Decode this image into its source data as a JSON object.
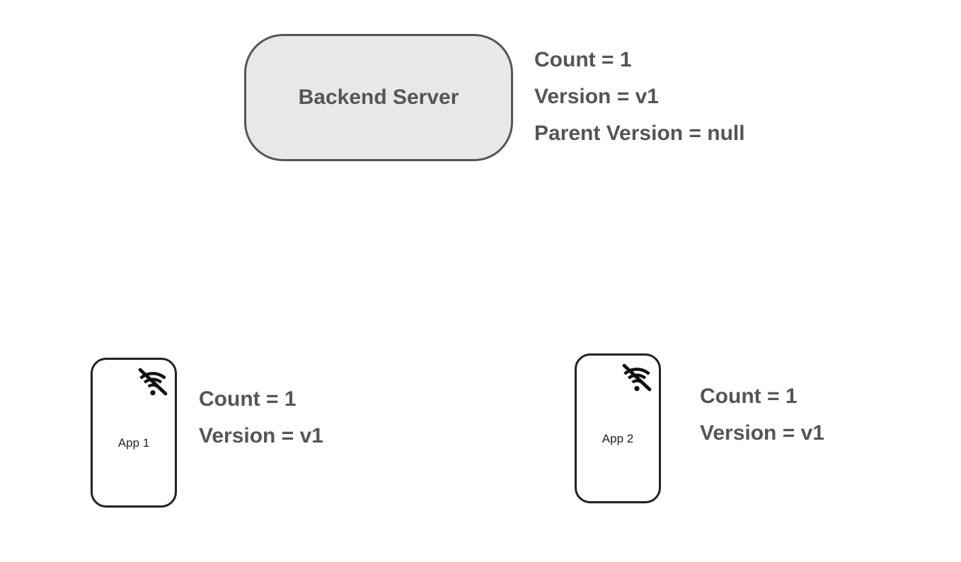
{
  "server": {
    "label": "Backend Server",
    "props": {
      "count": "Count = 1",
      "version": "Version = v1",
      "parent_version": "Parent Version = null"
    }
  },
  "clients": [
    {
      "label": "App 1",
      "props": {
        "count": "Count = 1",
        "version": "Version = v1"
      }
    },
    {
      "label": "App 2",
      "props": {
        "count": "Count = 1",
        "version": "Version = v1"
      }
    }
  ]
}
